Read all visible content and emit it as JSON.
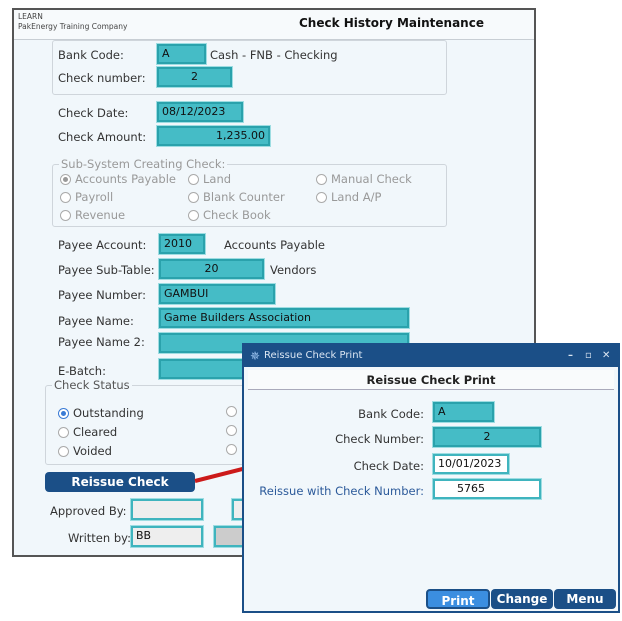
{
  "main": {
    "company_line1": "LEARN",
    "company_line2": "PakEnergy Training Company",
    "title": "Check History Maintenance",
    "bank_code_label": "Bank Code:",
    "bank_code": "A",
    "bank_desc": "Cash - FNB - Checking",
    "check_number_label": "Check number:",
    "check_number": "2",
    "check_date_label": "Check Date:",
    "check_date": "08/12/2023",
    "check_amount_label": "Check Amount:",
    "check_amount": "1,235.00",
    "subsystem": {
      "legend": "Sub-System Creating Check:",
      "options": [
        "Accounts Payable",
        "Land",
        "Manual Check",
        "Payroll",
        "Blank Counter",
        "Land A/P",
        "Revenue",
        "Check Book"
      ],
      "selected": "Accounts Payable"
    },
    "payee_account_label": "Payee Account:",
    "payee_account": "2010",
    "payee_account_desc": "Accounts Payable",
    "payee_subtable_label": "Payee Sub-Table:",
    "payee_subtable": "20",
    "payee_subtable_desc": "Vendors",
    "payee_number_label": "Payee Number:",
    "payee_number": "GAMBUI",
    "payee_name_label": "Payee Name:",
    "payee_name": "Game Builders Association",
    "payee_name2_label": "Payee Name 2:",
    "payee_name2": "",
    "ebatch_label": "E-Batch:",
    "ebatch": "",
    "status": {
      "legend": "Check Status",
      "options": [
        "Outstanding",
        "Cleared",
        "Voided"
      ],
      "selected": "Outstanding"
    },
    "reissue_button": "Reissue Check",
    "approved_by_label": "Approved By:",
    "approved_by": "",
    "written_by_label": "Written by:",
    "written_by": "BB"
  },
  "dialog": {
    "window_title": "Reissue Check Print",
    "header": "Reissue Check Print",
    "bank_code_label": "Bank Code:",
    "bank_code": "A",
    "check_number_label": "Check Number:",
    "check_number": "2",
    "check_date_label": "Check Date:",
    "check_date": "10/01/2023",
    "reissue_label": "Reissue with Check Number:",
    "reissue_number": "5765",
    "buttons": {
      "print": "Print",
      "change": "Change",
      "menu": "Menu"
    },
    "icons": [
      "app-icon",
      "minimize-icon",
      "maximize-icon",
      "close-icon"
    ]
  },
  "colors": {
    "field": "#45bcc6",
    "accent": "#1b4f87",
    "arrow": "#cc1a1a"
  }
}
